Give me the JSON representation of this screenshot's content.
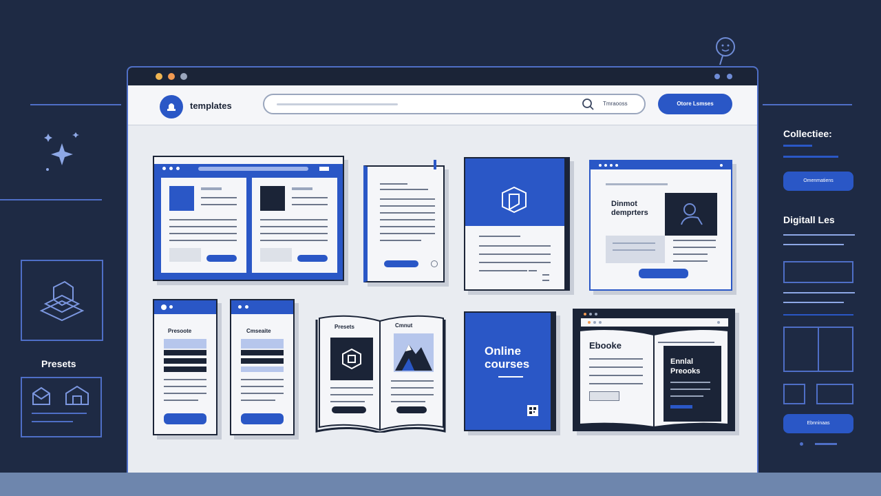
{
  "header": {
    "brand": "templates",
    "search_hint": "Tmraooss",
    "button_label": "Otore Lsmses"
  },
  "cards": {
    "ebook_spread_button": "",
    "digital_doc": {
      "title": "Dinmot\ndemprters",
      "button": ""
    },
    "narrow_left": {
      "title": "Presoote",
      "button": ""
    },
    "narrow_right": {
      "title": "Cmseaite",
      "button": ""
    },
    "open_book": {
      "left_title": "Presets",
      "right_title": "Cmnut"
    },
    "online_courses": {
      "title": "Online\ncourses"
    },
    "ebook_browser": {
      "title": "Ebooke",
      "panel_title": "Ennlal\nPreooks"
    }
  },
  "left_panel": {
    "presets_label": "Presets"
  },
  "right_panel": {
    "heading1": "Collectiee:",
    "button1": "Omenmatiens",
    "heading2": "Digitall Les",
    "button2": "Ebnninaas"
  },
  "colors": {
    "accent": "#2a57c6",
    "background": "#1e2a44",
    "page": "#e9ecf1"
  }
}
